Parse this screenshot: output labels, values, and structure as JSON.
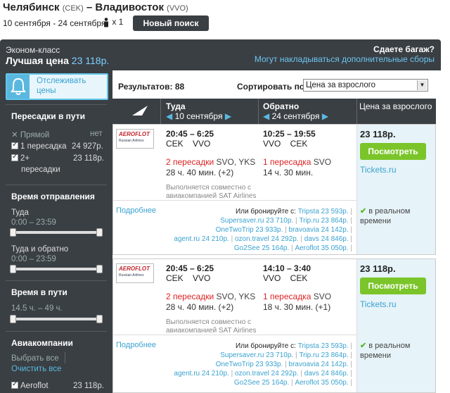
{
  "header": {
    "from_city": "Челябинск",
    "from_code": "(CEK)",
    "dash": "–",
    "to_city": "Владивосток",
    "to_code": "(VVO)",
    "dates": "10 сентября - 24 сентября",
    "passengers": "x 1",
    "new_search": "Новый поиск"
  },
  "band": {
    "class_label": "Эконом-класс",
    "best_price_label": "Лучшая цена",
    "best_price_value": "23 118р.",
    "baggage_question": "Сдаете багаж?",
    "baggage_note": "Могут накладываться дополнительные сборы"
  },
  "sidebar": {
    "track_label_1": "Отслеживать",
    "track_label_2": "цены",
    "stops_title": "Пересадки в пути",
    "stops": [
      {
        "label": "Прямой",
        "value": "нет",
        "checked": false
      },
      {
        "label": "1 пересадка",
        "value": "24 927р.",
        "checked": true
      },
      {
        "label": "2+",
        "label2": "пересадки",
        "value": "23 118р.",
        "checked": true
      }
    ],
    "departure_title": "Время отправления",
    "there_label": "Туда",
    "there_range": "0:00 – 23:59",
    "both_label": "Туда и обратно",
    "both_range": "0:00 – 23:59",
    "duration_title": "Время в пути",
    "duration_range": "14.5 ч. – 49 ч.",
    "airlines_title": "Авиакомпании",
    "select_all": "Выбрать все",
    "clear_all": "Очистить все",
    "airline_name": "Aeroflot",
    "airline_price": "23 118р."
  },
  "results": {
    "count": "Результатов: 88",
    "sort_label": "Сортировать по",
    "sort_value": "Цена за взрослого"
  },
  "columns": {
    "there": "Туда",
    "there_date": "10 сентября",
    "back": "Обратно",
    "back_date": "24 сентября",
    "price": "Цена за взрослого"
  },
  "cards": [
    {
      "logo": "AEROFLOT",
      "logo_sub": "Russian Airlines",
      "out_time": "20:45 – 6:25",
      "out_codes": "CEK    VVO",
      "out_stops_count": "2 пересадки",
      "out_stops_via": "SVO, YKS",
      "out_duration": "28 ч. 40 мин. (+2)",
      "operated": "Выполняется совместно с авиакомпанией SAT Airlines",
      "back_time": "10:25 – 19:55",
      "back_codes": "VVO    CEK",
      "back_stops_count": "1 пересадка",
      "back_stops_via": "SVO",
      "back_duration": "14 ч. 30 мин.",
      "price": "23 118р.",
      "button": "Посмотреть",
      "vendor": "Tickets.ru",
      "more": "Подробнее",
      "book_label": "Или бронируйте с:",
      "book_lines": [
        [
          "Tripsta 23 593р."
        ],
        [
          "Supersaver.ru 23 710р.",
          "Trip.ru 23 864р."
        ],
        [
          "OneTwoTrip 23 933р.",
          "bravoavia 24 142р."
        ],
        [
          "agent.ru 24 210р.",
          "ozon.travel 24 292р.",
          "davs 24 846р."
        ],
        [
          "Go2See 25 164р.",
          "Aeroflot 35 050р."
        ]
      ],
      "realtime_1": "в реальном",
      "realtime_2": "времени"
    },
    {
      "logo": "AEROFLOT",
      "logo_sub": "Russian Airlines",
      "out_time": "20:45 – 6:25",
      "out_codes": "CEK    VVO",
      "out_stops_count": "2 пересадки",
      "out_stops_via": "SVO, YKS",
      "out_duration": "28 ч. 40 мин. (+2)",
      "operated": "Выполняется совместно с авиакомпанией SAT Airlines",
      "back_time": "14:10 – 3:40",
      "back_codes": "VVO    CEK",
      "back_stops_count": "1 пересадка",
      "back_stops_via": "SVO",
      "back_duration": "18 ч. 30 мин. (+1)",
      "price": "23 118р.",
      "button": "Посмотреть",
      "vendor": "Tickets.ru",
      "more": "Подробнее",
      "book_label": "Или бронируйте с:",
      "book_lines": [
        [
          "Tripsta 23 593р."
        ],
        [
          "Supersaver.ru 23 710р.",
          "Trip.ru 23 864р."
        ],
        [
          "OneTwoTrip 23 933р.",
          "bravoavia 24 142р."
        ],
        [
          "agent.ru 24 210р.",
          "ozon.travel 24 292р.",
          "davs 24 846р."
        ],
        [
          "Go2See 25 164р.",
          "Aeroflot 35 050р."
        ]
      ],
      "realtime_1": "в реальном",
      "realtime_2": "времени"
    }
  ]
}
